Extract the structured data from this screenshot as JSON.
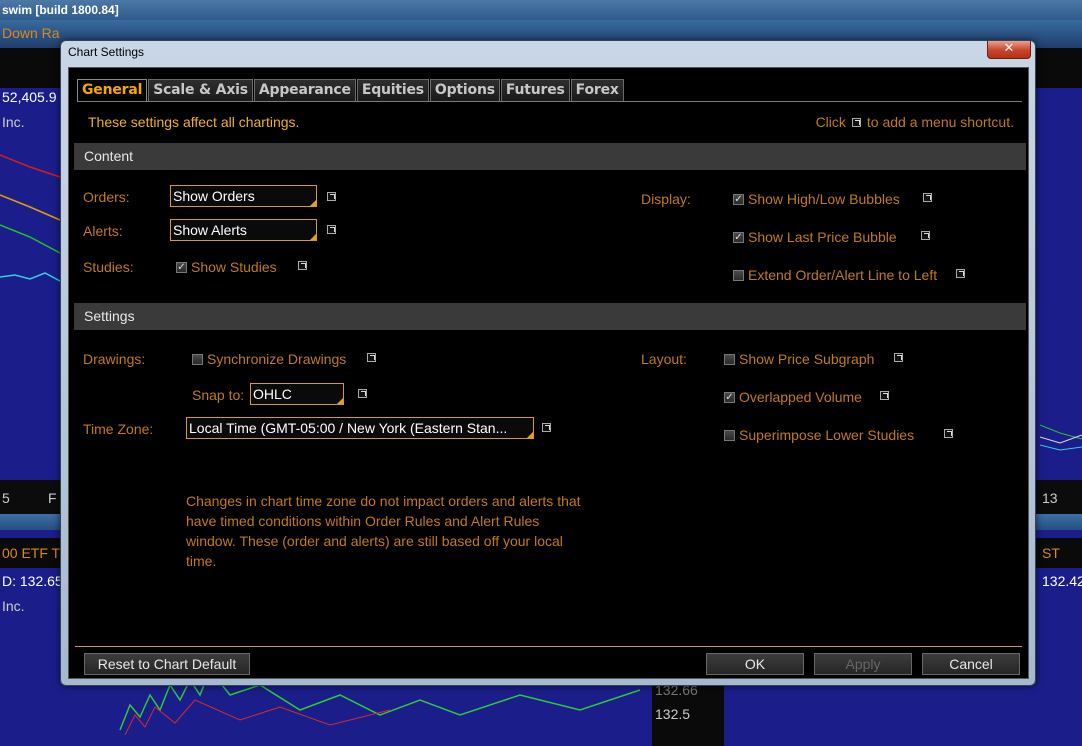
{
  "background": {
    "title_fragment": "swim [build 1800.84]",
    "text_down": "Down Ra",
    "text_price1": "52,405.9",
    "text_inc1": "Inc.",
    "text_5": "5",
    "text_f": "F",
    "text_13": "13",
    "text_etf": "00 ETF T",
    "text_st": "ST",
    "text_price2": "D: 132.65",
    "text_price3": "132.42",
    "text_inc2": "Inc.",
    "text_price4": "132.66",
    "text_price5": "132.5"
  },
  "dialog": {
    "title": "Chart Settings",
    "close_glyph": "✕",
    "tabs": [
      {
        "label": "General",
        "active": true
      },
      {
        "label": "Scale & Axis",
        "active": false
      },
      {
        "label": "Appearance",
        "active": false
      },
      {
        "label": "Equities",
        "active": false
      },
      {
        "label": "Options",
        "active": false
      },
      {
        "label": "Futures",
        "active": false
      },
      {
        "label": "Forex",
        "active": false
      }
    ],
    "info_left": "These settings affect all chartings.",
    "info_right_pre": "Click",
    "info_right_post": "to add a menu shortcut.",
    "content": {
      "header": "Content",
      "orders_label": "Orders:",
      "orders_value": "Show Orders",
      "alerts_label": "Alerts:",
      "alerts_value": "Show Alerts",
      "studies_label": "Studies:",
      "show_studies": "Show Studies",
      "display_label": "Display:",
      "show_high_low": "Show High/Low Bubbles",
      "show_last_price": "Show Last Price Bubble",
      "extend_line": "Extend Order/Alert Line to Left"
    },
    "settings": {
      "header": "Settings",
      "drawings_label": "Drawings:",
      "sync_drawings": "Synchronize Drawings",
      "snap_label": "Snap to:",
      "snap_value": "OHLC",
      "timezone_label": "Time Zone:",
      "timezone_value": "Local Time (GMT-05:00 / New York (Eastern Stan...",
      "note": "Changes in chart time zone do not impact orders and alerts that have timed conditions within Order Rules and Alert Rules window. These (order and alerts) are still based off your local time.",
      "layout_label": "Layout:",
      "show_price_subgraph": "Show Price Subgraph",
      "overlapped_volume": "Overlapped Volume",
      "superimpose": "Superimpose Lower Studies"
    },
    "checkbox_states": {
      "show_studies": true,
      "show_high_low": true,
      "show_last_price": true,
      "extend_line": false,
      "sync_drawings": false,
      "show_price_subgraph": false,
      "overlapped_volume": true,
      "superimpose": false
    },
    "check_glyph": "✓",
    "footer": {
      "reset": "Reset to Chart Default",
      "ok": "OK",
      "apply": "Apply",
      "cancel": "Cancel"
    }
  }
}
